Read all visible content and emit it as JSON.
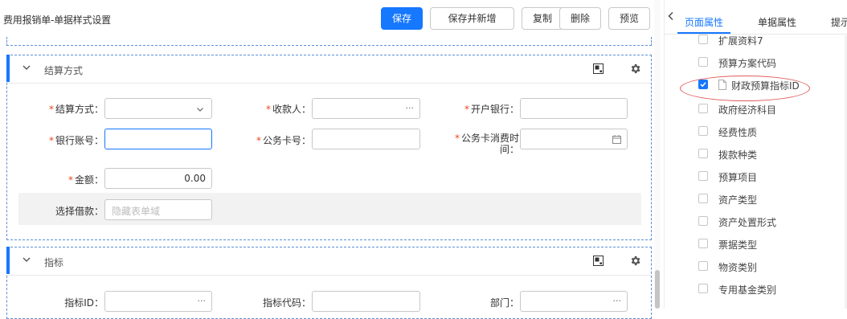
{
  "header": {
    "title": "费用报销单-单据样式设置",
    "buttons": {
      "save": "保存",
      "save_new": "保存并新增",
      "copy": "复制",
      "delete": "删除",
      "preview": "预览"
    }
  },
  "sections": {
    "settlement": {
      "title": "结算方式",
      "fields": {
        "settle_method": {
          "label": "结算方式：",
          "required": "*",
          "value": ""
        },
        "payee": {
          "label": "收款人：",
          "required": "*",
          "suffix": "···"
        },
        "bank": {
          "label": "开户银行：",
          "required": "*"
        },
        "account": {
          "label": "银行账号：",
          "required": "*"
        },
        "card_no": {
          "label": "公务卡号：",
          "required": "*"
        },
        "card_time": {
          "label_line1": "公务卡消费时",
          "label_line2": "间：",
          "required": "*"
        },
        "amount": {
          "label": "金额：",
          "required": "*",
          "value": "0.00"
        },
        "loan": {
          "label": "选择借款：",
          "placeholder": "隐藏表单域"
        }
      }
    },
    "indicator": {
      "title": "指标",
      "fields": {
        "indicator_id": {
          "label": "指标ID：",
          "suffix": "···"
        },
        "indicator_code": {
          "label": "指标代码："
        },
        "dept": {
          "label": "部门：",
          "suffix": "···"
        }
      }
    }
  },
  "panel": {
    "tabs": [
      "页面属性",
      "单据属性",
      "提示"
    ],
    "active_tab": "页面属性",
    "items": [
      {
        "label": "扩展资料7",
        "checked": false
      },
      {
        "label": "预算方案代码",
        "checked": false
      },
      {
        "label": "财政预算指标ID",
        "checked": true
      },
      {
        "label": "政府经济科目",
        "checked": false
      },
      {
        "label": "经费性质",
        "checked": false
      },
      {
        "label": "拨款种类",
        "checked": false
      },
      {
        "label": "预算项目",
        "checked": false
      },
      {
        "label": "资产类型",
        "checked": false
      },
      {
        "label": "资产处置形式",
        "checked": false
      },
      {
        "label": "票据类型",
        "checked": false
      },
      {
        "label": "物资类别",
        "checked": false
      },
      {
        "label": "专用基金类别",
        "checked": false
      }
    ]
  },
  "colors": {
    "primary": "#1677ff",
    "required": "#e8491d",
    "highlight_ellipse": "#e05a5a",
    "section_border": "#5b8fd6"
  },
  "icons": [
    "chevron-down-icon",
    "layout-icon",
    "gear-icon",
    "calendar-icon",
    "chevron-left-icon",
    "document-icon",
    "check-icon"
  ]
}
